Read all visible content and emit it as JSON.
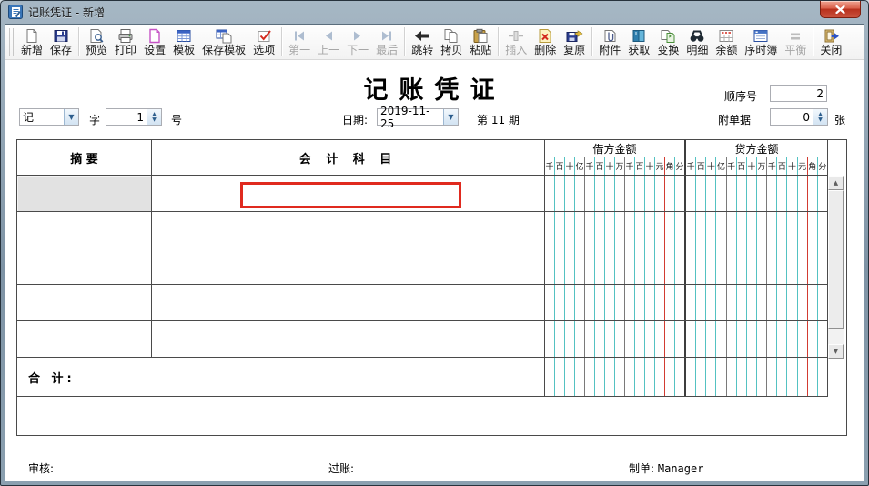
{
  "window": {
    "title": "记账凭证 - 新增"
  },
  "toolbar": {
    "buttons": [
      {
        "label": "新增",
        "disabled": false
      },
      {
        "label": "保存",
        "disabled": false
      },
      {
        "label": "预览",
        "disabled": false
      },
      {
        "label": "打印",
        "disabled": false
      },
      {
        "label": "设置",
        "disabled": false
      },
      {
        "label": "模板",
        "disabled": false
      },
      {
        "label": "保存模板",
        "disabled": false
      },
      {
        "label": "选项",
        "disabled": false
      },
      {
        "label": "第一",
        "disabled": true
      },
      {
        "label": "上一",
        "disabled": true
      },
      {
        "label": "下一",
        "disabled": true
      },
      {
        "label": "最后",
        "disabled": true
      },
      {
        "label": "跳转",
        "disabled": false
      },
      {
        "label": "拷贝",
        "disabled": false
      },
      {
        "label": "粘贴",
        "disabled": false
      },
      {
        "label": "插入",
        "disabled": true
      },
      {
        "label": "删除",
        "disabled": false
      },
      {
        "label": "复原",
        "disabled": false
      },
      {
        "label": "附件",
        "disabled": false
      },
      {
        "label": "获取",
        "disabled": false
      },
      {
        "label": "变换",
        "disabled": false
      },
      {
        "label": "明细",
        "disabled": false
      },
      {
        "label": "余额",
        "disabled": false
      },
      {
        "label": "序时簿",
        "disabled": false
      },
      {
        "label": "平衡",
        "disabled": true
      },
      {
        "label": "关闭",
        "disabled": false
      }
    ]
  },
  "header": {
    "form_title": "记账凭证",
    "seq_label": "顺序号",
    "seq_value": "2",
    "word_value": "记",
    "word_suffix": "字",
    "num_value": "1",
    "num_suffix": "号",
    "date_label": "日期:",
    "date_value": "2019-11-25",
    "period_text": "第 11 期",
    "attach_label": "附单据",
    "attach_value": "0",
    "attach_unit": "张"
  },
  "table": {
    "summary_header": "摘  要",
    "account_header": "会 计 科 目",
    "debit_header": "借方金额",
    "credit_header": "贷方金额",
    "digit_columns": [
      "千",
      "百",
      "十",
      "亿",
      "千",
      "百",
      "十",
      "万",
      "千",
      "百",
      "十",
      "元",
      "角",
      "分"
    ],
    "body_row_count": 5,
    "total_label": "合 计:"
  },
  "footer": {
    "audit_label": "审核:",
    "post_label": "过账:",
    "prepared_label": "制单:",
    "prepared_by": "Manager"
  },
  "icons": {
    "dropdown": "▼",
    "spin_up": "▲",
    "spin_down": "▼",
    "scroll_up": "▲",
    "scroll_down": "▼"
  },
  "colors": {
    "active_cell_border": "#e02a1f",
    "grid_minor_line": "#54c2c2",
    "grid_group_line": "#7a7a7a",
    "grid_yuan_line": "#d23b31",
    "grid_dark_line": "#4a4a4a",
    "selected_cell_bg": "#e2e2e2"
  }
}
